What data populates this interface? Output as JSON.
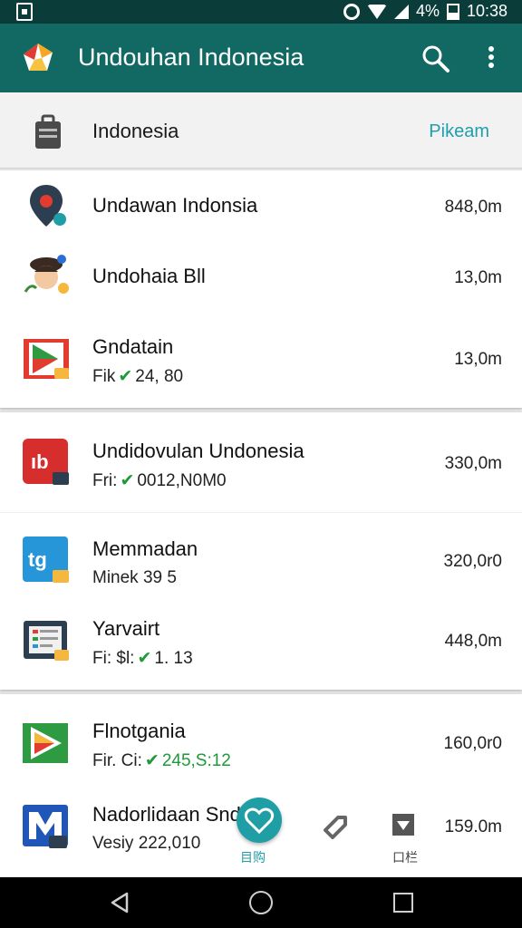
{
  "status_bar": {
    "battery": "4%",
    "time": "10:38"
  },
  "app_bar": {
    "title": "Undouhan Indonesia",
    "brand_color": "#126863"
  },
  "country_row": {
    "label": "Indonesia",
    "action": "Pikeam"
  },
  "groups": [
    {
      "items": [
        {
          "title": "Undawan Indonsia",
          "subtitle": "",
          "size": "848,0m",
          "icon": "map-pin-icon"
        },
        {
          "title": "Undohaia Bll",
          "subtitle": "",
          "size": "13,0m",
          "icon": "avatar-icon"
        },
        {
          "title": "Gndatain",
          "subtitle_prefix": "Fik",
          "subtitle_value": "24, 80",
          "size": "13,0m",
          "icon": "play-store-icon"
        }
      ]
    },
    {
      "items": [
        {
          "title": "Undidovulan Undonesia",
          "subtitle_prefix": "Fri:",
          "subtitle_value": "0012,N0M0",
          "size": "330,0m",
          "icon": "ib-icon"
        },
        {
          "title": "Memmadan",
          "subtitle": "Minek 39 5",
          "size": "320,0r0",
          "icon": "tg-icon"
        },
        {
          "title": "Yarvairt",
          "subtitle_prefix": "Fi: $l:",
          "subtitle_value": "1. 13",
          "size": "448,0m",
          "icon": "document-icon"
        }
      ]
    },
    {
      "items": [
        {
          "title": "Flnotgania",
          "subtitle_prefix": "Fir. Ci:",
          "subtitle_value": "245,S:12",
          "size": "160,0r0",
          "icon": "play-icon"
        },
        {
          "title": "Nadorlidaan Sndann",
          "subtitle": "Vesiy 222,010",
          "size": "159.0m",
          "icon": "m-icon"
        }
      ]
    }
  ],
  "bottom_tabs": {
    "main_label": "目购",
    "download_label": "口栏"
  },
  "colors": {
    "accent": "#1f9ea6",
    "check": "#1f9a38"
  }
}
